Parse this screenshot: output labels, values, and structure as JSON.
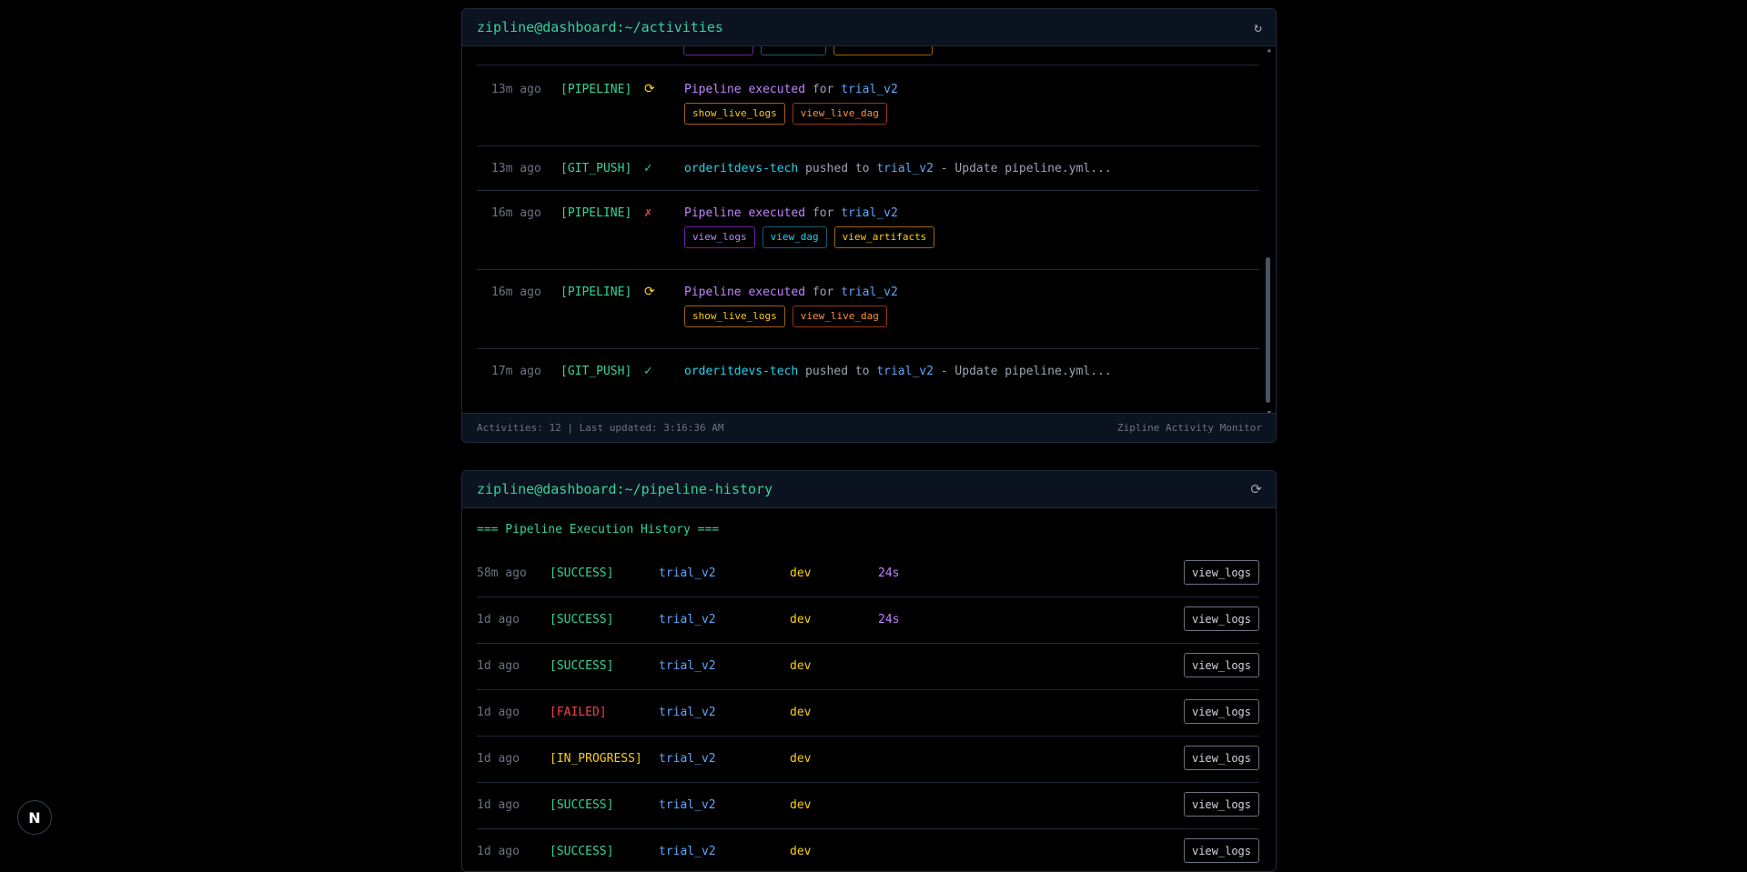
{
  "activities": {
    "title": "zipline@dashboard:~/activities",
    "refresh_icon": "refresh-icon",
    "rows": [
      {
        "time": "13m ago",
        "type": "[PIPELINE]",
        "status_icon": "⟳",
        "status_color": "#facc15",
        "kind": "pipeline",
        "m1": "Pipeline executed",
        "m2": " for ",
        "m3": "trial_v2",
        "tags": [
          {
            "label": "show_live_logs",
            "style": "yellow"
          },
          {
            "label": "view_live_dag",
            "style": "orange"
          }
        ]
      },
      {
        "time": "13m ago",
        "type": "[GIT_PUSH]",
        "status_icon": "✓",
        "status_color": "#34d399",
        "kind": "push",
        "m1": "orderitdevs-tech",
        "m2": " pushed to ",
        "m3": "trial_v2",
        "m4": " - Update pipeline.yml..."
      },
      {
        "time": "16m ago",
        "type": "[PIPELINE]",
        "status_icon": "✗",
        "status_color": "#ef4444",
        "kind": "pipeline",
        "m1": "Pipeline executed",
        "m2": " for ",
        "m3": "trial_v2",
        "tags": [
          {
            "label": "view_logs",
            "style": "purple"
          },
          {
            "label": "view_dag",
            "style": "cyan"
          },
          {
            "label": "view_artifacts",
            "style": "yellow"
          }
        ]
      },
      {
        "time": "16m ago",
        "type": "[PIPELINE]",
        "status_icon": "⟳",
        "status_color": "#facc15",
        "kind": "pipeline",
        "m1": "Pipeline executed",
        "m2": " for ",
        "m3": "trial_v2",
        "tags": [
          {
            "label": "show_live_logs",
            "style": "yellow"
          },
          {
            "label": "view_live_dag",
            "style": "orange"
          }
        ]
      },
      {
        "time": "17m ago",
        "type": "[GIT_PUSH]",
        "status_icon": "✓",
        "status_color": "#34d399",
        "kind": "push",
        "m1": "orderitdevs-tech",
        "m2": " pushed to ",
        "m3": "trial_v2",
        "m4": " - Update pipeline.yml..."
      }
    ],
    "footer_left": "Activities: 12 | Last updated: 3:16:36 AM",
    "footer_right": "Zipline Activity Monitor"
  },
  "history": {
    "title": "zipline@dashboard:~/pipeline-history",
    "refresh_icon": "refresh-icon",
    "heading": "=== Pipeline Execution History ===",
    "rows": [
      {
        "time": "58m ago",
        "status": "[SUCCESS]",
        "status_color": "#34d399",
        "branch": "trial_v2",
        "env": "dev",
        "duration": "24s",
        "button": "view_logs"
      },
      {
        "time": "1d ago",
        "status": "[SUCCESS]",
        "status_color": "#34d399",
        "branch": "trial_v2",
        "env": "dev",
        "duration": "24s",
        "button": "view_logs"
      },
      {
        "time": "1d ago",
        "status": "[SUCCESS]",
        "status_color": "#34d399",
        "branch": "trial_v2",
        "env": "dev",
        "duration": "",
        "button": "view_logs"
      },
      {
        "time": "1d ago",
        "status": "[FAILED]",
        "status_color": "#ef4444",
        "branch": "trial_v2",
        "env": "dev",
        "duration": "",
        "button": "view_logs"
      },
      {
        "time": "1d ago",
        "status": "[IN_PROGRESS]",
        "status_color": "#facc15",
        "branch": "trial_v2",
        "env": "dev",
        "duration": "",
        "button": "view_logs"
      },
      {
        "time": "1d ago",
        "status": "[SUCCESS]",
        "status_color": "#34d399",
        "branch": "trial_v2",
        "env": "dev",
        "duration": "",
        "button": "view_logs"
      },
      {
        "time": "1d ago",
        "status": "[SUCCESS]",
        "status_color": "#34d399",
        "branch": "trial_v2",
        "env": "dev",
        "duration": "",
        "button": "view_logs"
      }
    ]
  },
  "badge": {
    "label": "N",
    "icon": "nextjs-logo-icon"
  }
}
